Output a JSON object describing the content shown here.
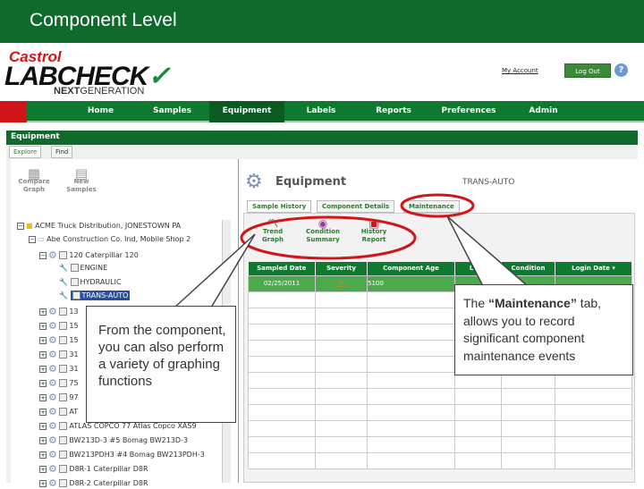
{
  "slide_title": "Component Level",
  "logo": {
    "brand": "Castrol",
    "product": "LABCHECK",
    "tag_bold": "NEXT",
    "tag_rest": "GENERATION"
  },
  "header": {
    "my_account": "My Account",
    "log_out": "Log Out",
    "help": "?"
  },
  "nav": [
    "Home",
    "Samples",
    "Equipment",
    "Labels",
    "Reports",
    "Preferences",
    "Admin"
  ],
  "section_title": "Equipment",
  "left_tabs": [
    "Explore",
    "Find"
  ],
  "left_tools": [
    {
      "l1": "Compare",
      "l2": "Graph"
    },
    {
      "l1": "New",
      "l2": "Samples"
    }
  ],
  "tree": {
    "root": "ACME Truck Distribution, JONESTOWN PA",
    "site": "Abe Construction Co. Ind, Mobile Shop 2",
    "unit": "120 Caterpillar 120",
    "components": [
      "ENGINE",
      "HYDRAULIC",
      "TRANS-AUTO"
    ],
    "units": [
      "13",
      "15",
      "15",
      "31",
      "31",
      "75",
      "97",
      "AT",
      "ATLAS COPCO 77 Atlas Copco XAS9",
      "BW213D-3 #5 Bomag BW213D-3",
      "BW213PDH3 #4 Bomag BW213PDH-3",
      "D8R-1 Caterpillar D8R",
      "D8R-2 Caterpillar D8R"
    ]
  },
  "panel": {
    "title": "Equipment",
    "selected": "TRANS-AUTO",
    "tabs": [
      "Sample History",
      "Component Details",
      "Maintenance"
    ],
    "tools": [
      {
        "l1": "Trend",
        "l2": "Graph"
      },
      {
        "l1": "Condition",
        "l2": "Summary"
      },
      {
        "l1": "History",
        "l2": "Report"
      }
    ]
  },
  "table": {
    "headers": [
      "Sampled Date",
      "Severity",
      "Component Age",
      "Lube",
      "Condition",
      "Login Date ▾"
    ],
    "rows": [
      [
        "02/25/2011",
        "⚠",
        "5100",
        "",
        "",
        ""
      ]
    ]
  },
  "callouts": {
    "left": "From the component, you can also perform a variety of graphing functions",
    "right_pre": "The ",
    "right_bold": "“Maintenance”",
    "right_post": " tab, allows you to record significant component maintenance events"
  },
  "colors": {
    "green": "#0d7a30",
    "red": "#d0161b"
  }
}
